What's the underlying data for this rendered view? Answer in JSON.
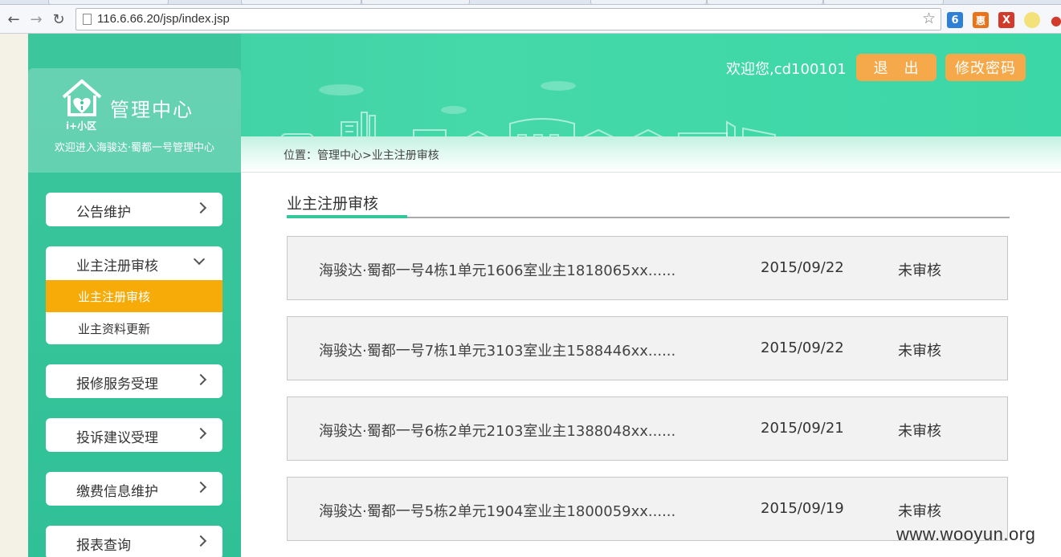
{
  "browser": {
    "url": "116.6.66.20/jsp/index.jsp",
    "back_icon": "back-arrow-icon",
    "forward_icon": "forward-arrow-icon",
    "reload_icon": "reload-icon",
    "extensions": [
      {
        "name": "extension-blue-icon",
        "glyph": "6",
        "color": "#2e7fd6"
      },
      {
        "name": "extension-orange-icon",
        "glyph": "惠",
        "color": "#e8731a"
      },
      {
        "name": "extension-red-icon",
        "glyph": "X",
        "color": "#d23b2b"
      }
    ]
  },
  "header": {
    "welcome": "欢迎您,cd100101",
    "logout_label": "退　出",
    "change_password_label": "修改密码"
  },
  "logo": {
    "subtitle": "i+小区",
    "title": "管理中心",
    "welcome": "欢迎进入海骏达·蜀都一号管理中心"
  },
  "breadcrumb": "位置：管理中心>业主注册审核",
  "sidebar": {
    "items": [
      {
        "label": "公告维护"
      },
      {
        "label": "业主注册审核",
        "expanded": true,
        "children": [
          {
            "label": "业主注册审核",
            "active": true
          },
          {
            "label": "业主资料更新",
            "active": false
          }
        ]
      },
      {
        "label": "报修服务受理"
      },
      {
        "label": "投诉建议受理"
      },
      {
        "label": "缴费信息维护"
      },
      {
        "label": "报表查询"
      }
    ]
  },
  "main": {
    "title": "业主注册审核",
    "rows": [
      {
        "desc": "海骏达·蜀都一号4栋1单元1606室业主1818065xx......",
        "date": "2015/09/22",
        "status": "未审核"
      },
      {
        "desc": "海骏达·蜀都一号7栋1单元3103室业主1588446xx......",
        "date": "2015/09/22",
        "status": "未审核"
      },
      {
        "desc": "海骏达·蜀都一号6栋2单元2103室业主1388048xx......",
        "date": "2015/09/21",
        "status": "未审核"
      },
      {
        "desc": "海骏达·蜀都一号5栋2单元1904室业主1800059xx......",
        "date": "2015/09/19",
        "status": "未审核"
      }
    ]
  },
  "watermark": "www.wooyun.org",
  "colors": {
    "accent": "#3cd0a3",
    "active_menu": "#f7ab09",
    "header_button": "#f5a94a"
  }
}
